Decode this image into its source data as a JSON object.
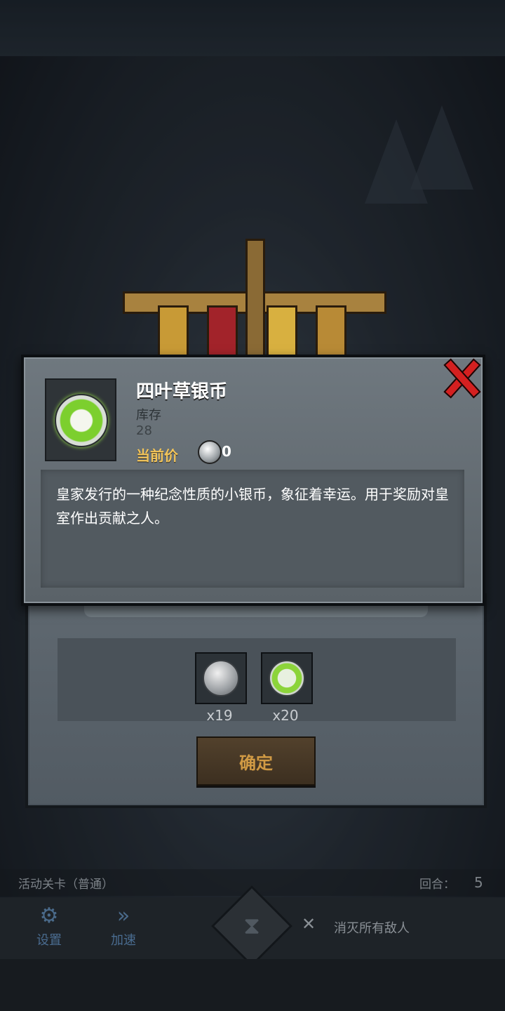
{
  "item": {
    "name": "四叶草银币",
    "stock_label": "库存",
    "stock_value": "28",
    "price_label": "当前价",
    "price_value": "0",
    "description": "皇家发行的一种纪念性质的小银币，象征着幸运。用于奖励对皇室作出贡献之人。"
  },
  "rewards": [
    {
      "icon": "silver-coin-icon",
      "count": "x19"
    },
    {
      "icon": "clover-silver-coin-icon",
      "count": "x20"
    }
  ],
  "confirm_label": "确定",
  "hud": {
    "stage": "活动关卡（普通）",
    "round_label": "回合：",
    "round_value": "5",
    "settings_label": "设置",
    "speed_label": "加速",
    "objective": "消灭所有敌人"
  },
  "colors": {
    "close": "#d42020",
    "price_label": "#f2c45a",
    "confirm_text": "#d09a44",
    "coin_green": "#7ccf2e"
  }
}
